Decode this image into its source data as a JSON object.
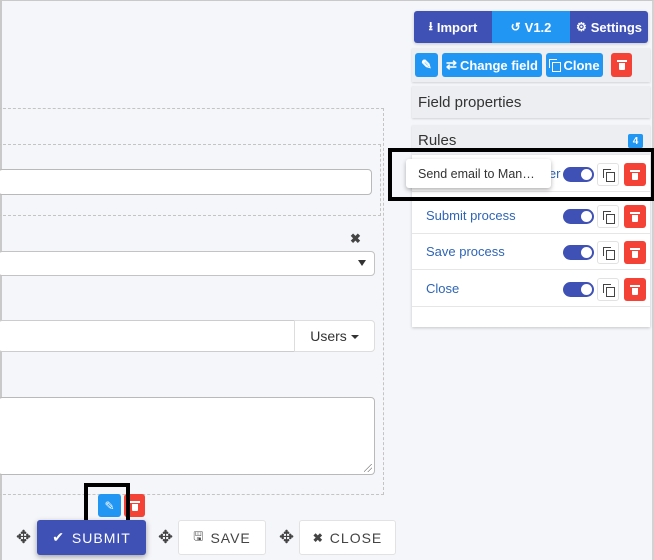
{
  "toolbar_top": {
    "import_label": "Import",
    "import_icon": "download-icon",
    "version_label": "V1.2",
    "version_icon": "history-icon",
    "settings_label": "Settings",
    "settings_icon": "gear-icon"
  },
  "field_toolbar": {
    "edit_icon": "pencil-icon",
    "change_field_label": "Change field",
    "change_field_icon": "exchange-icon",
    "clone_label": "Clone",
    "clone_icon": "copy-icon",
    "delete_icon": "trash-icon"
  },
  "sections": {
    "field_properties": "Field properties",
    "rules": "Rules",
    "rules_count": "4"
  },
  "rules": [
    {
      "label": "Send email to Manager",
      "enabled": true
    },
    {
      "label": "Submit process",
      "enabled": true
    },
    {
      "label": "Save process",
      "enabled": true
    },
    {
      "label": "Close",
      "enabled": true
    }
  ],
  "tooltip": {
    "text": "Send email to Man…"
  },
  "form": {
    "text_input_value": "",
    "select_value": "",
    "remove_icon": "close-x-icon",
    "user_input_value": "",
    "users_button_label": "Users",
    "textarea_value": ""
  },
  "actions": {
    "submit_label": "SUBMIT",
    "submit_icon": "check-icon",
    "save_label": "SAVE",
    "save_icon": "floppy-disk-icon",
    "close_label": "CLOSE",
    "close_icon": "x-icon",
    "move_icon": "move-arrows-icon"
  },
  "colors": {
    "primary": "#3f51b5",
    "accent": "#2196f3",
    "danger": "#f44336",
    "link": "#2f65b5"
  }
}
